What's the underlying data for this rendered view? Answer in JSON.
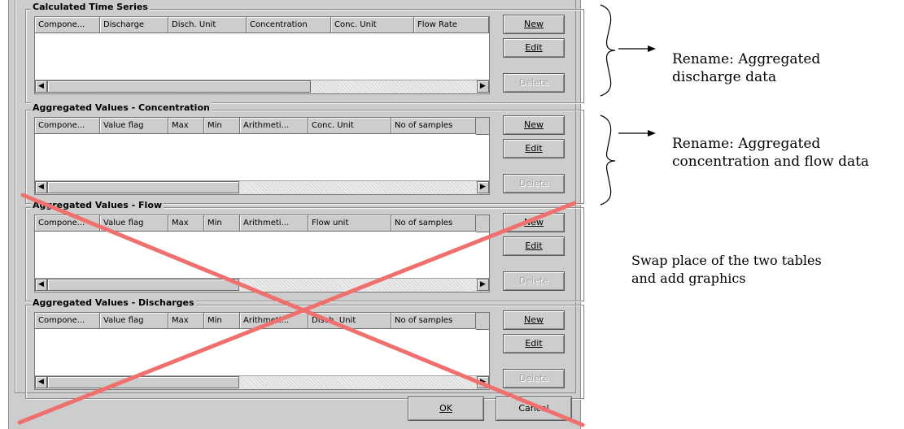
{
  "groups": [
    {
      "title": "Calculated Time Series",
      "columns": [
        "Compone...",
        "Discharge",
        "Disch. Unit",
        "Concentration",
        "Conc. Unit",
        "Flow Rate"
      ],
      "buttons": {
        "new": "New",
        "edit": "Edit",
        "delete": "Delete"
      }
    },
    {
      "title": "Aggregated Values - Concentration",
      "columns": [
        "Compone...",
        "Value flag",
        "Max",
        "Min",
        "Arithmeti...",
        "Conc. Unit",
        "No of samples"
      ],
      "buttons": {
        "new": "New",
        "edit": "Edit",
        "delete": "Delete"
      }
    },
    {
      "title": "Aggregated Values - Flow",
      "columns": [
        "Compone...",
        "Value flag",
        "Max",
        "Min",
        "Arithmeti...",
        "Flow unit",
        "No of samples"
      ],
      "buttons": {
        "new": "New",
        "edit": "Edit",
        "delete": "Delete"
      }
    },
    {
      "title": "Aggregated Values - Discharges",
      "columns": [
        "Compone...",
        "Value flag",
        "Max",
        "Min",
        "Arithmeti...",
        "Disch. Unit",
        "No of samples"
      ],
      "buttons": {
        "new": "New",
        "edit": "Edit",
        "delete": "Delete"
      }
    }
  ],
  "dialog_buttons": {
    "ok": "OK",
    "cancel": "Cancel"
  },
  "annotations": {
    "rename_discharge_line1": "Rename: Aggregated",
    "rename_discharge_line2": "discharge  data",
    "rename_conc_line1": "Rename: Aggregated",
    "rename_conc_line2": "concentration and flow data",
    "swap_line1": "Swap place of the two tables",
    "swap_line2": "and add graphics"
  },
  "colors": {
    "dialog_bg": "#cdcdcd",
    "cross": "#f0706e",
    "disabled_text": "#a3a3a3"
  },
  "icons": {
    "scroll_left": "triangle-left",
    "scroll_right": "triangle-right",
    "annotation_arrow": "arrow-right"
  }
}
